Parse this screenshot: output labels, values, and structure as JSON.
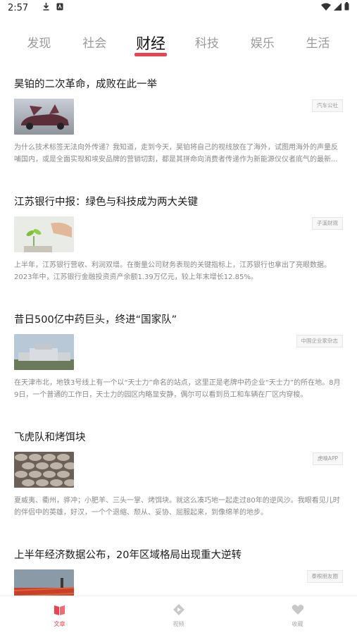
{
  "status_bar": {
    "time": "2:57"
  },
  "tabs": [
    {
      "label": "发现",
      "active": false
    },
    {
      "label": "社会",
      "active": false
    },
    {
      "label": "财经",
      "active": true
    },
    {
      "label": "科技",
      "active": false
    },
    {
      "label": "娱乐",
      "active": false
    },
    {
      "label": "生活",
      "active": false
    }
  ],
  "articles": [
    {
      "title": "昊铂的二次革命，成败在此一举",
      "source": "汽车公社",
      "excerpt": "为什么技术标签无法向外传递？我知道，走到今天，昊铂将自己的视线放在了海外，试图用海外的声量反哺国内，或是全面实现和埃安品牌的营销切割，都是其拼命向消费者传递作为新能源仪仪者底气的最新..."
    },
    {
      "title": "江苏银行中报：绿色与科技成为两大关键",
      "source": "子溪财观",
      "excerpt": "上半年，江苏银行营收、利润双增。在衡量公司财务表现的关键指标上，江苏银行也拿出了亮眼数据。2023年中，江苏银行金融投资资产余额1.39万亿元，较上年末增长12.85%。"
    },
    {
      "title": "昔日500亿中药巨头，终进“国家队”",
      "source": "中国企业家杂志",
      "excerpt": "在天津市北，地铁3号线上有一个以“天士力”命名的站点，这里正是老牌中药企业“天士力”的所在地。8月9日，一个普通的工作日，天士力的园区内略显安静，偶尔可以看到员工和车辆在厂区内穿梭。"
    },
    {
      "title": "飞虎队和烤饵块",
      "source": "虎嗅APP",
      "excerpt": "夏威夷、衢州，骅冲；小肥羊、三头一掌、烤饵块。就这么凑巧地一起走过80年的逆风沙。我眼看见儿时的伴侣中的英雄，好汉，一个个退缩、颓从、妥协、屈服起来，到像绵羊的地步。"
    },
    {
      "title": "上半年经济数据公布，20年区域格局出现重大逆转",
      "source": "泰根朋友圈",
      "excerpt": ""
    }
  ],
  "bottom_nav": [
    {
      "label": "文章",
      "icon": "article-icon",
      "active": true
    },
    {
      "label": "视频",
      "icon": "video-icon",
      "active": false
    },
    {
      "label": "收藏",
      "icon": "heart-icon",
      "active": false
    }
  ],
  "colors": {
    "accent": "#e8434f",
    "muted": "#9a9a9a"
  }
}
